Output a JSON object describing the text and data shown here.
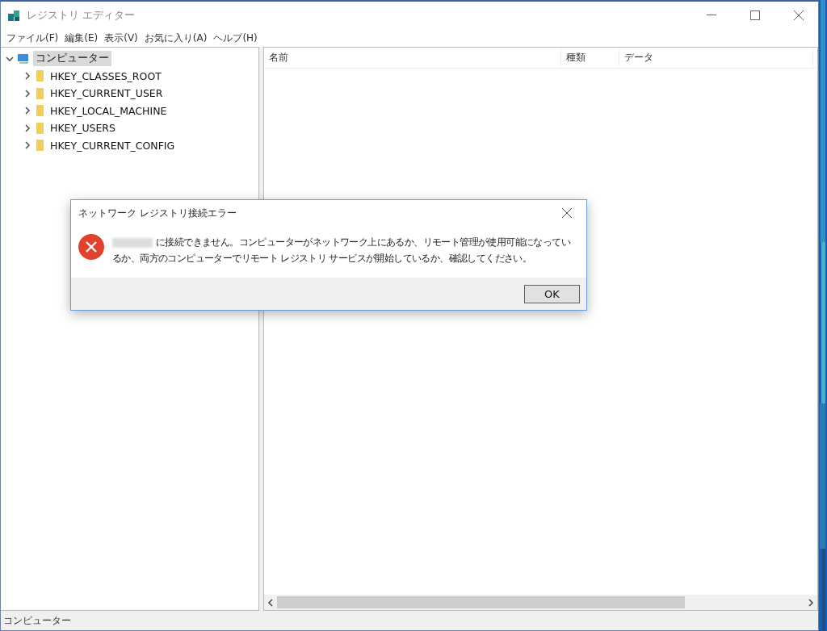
{
  "window": {
    "title": "レジストリ エディター"
  },
  "menu": [
    "ファイル(F)",
    "編集(E)",
    "表示(V)",
    "お気に入り(A)",
    "ヘルプ(H)"
  ],
  "tree": [
    {
      "label": "コンピューター",
      "selected": true,
      "expanded": true,
      "children": [
        {
          "label": "HKEY_CLASSES_ROOT",
          "selected": false,
          "expanded": false
        },
        {
          "label": "HKEY_CURRENT_USER",
          "selected": false,
          "expanded": false
        },
        {
          "label": "HKEY_LOCAL_MACHINE",
          "selected": false,
          "expanded": false
        },
        {
          "label": "HKEY_USERS",
          "selected": false,
          "expanded": false
        },
        {
          "label": "HKEY_CURRENT_CONFIG",
          "selected": false,
          "expanded": false
        }
      ]
    }
  ],
  "list": {
    "columns": [
      "名前",
      "種類",
      "データ"
    ]
  },
  "status_bar": "コンピューター",
  "dialog": {
    "title": "ネットワーク レジストリ接続エラー",
    "message": "に接続できません。コンピューターがネットワーク上にあるか、リモート管理が使用可能になっているか、両方のコンピューターでリモート レジストリ サービスが開始しているか、確認してください。",
    "button": "OK"
  }
}
